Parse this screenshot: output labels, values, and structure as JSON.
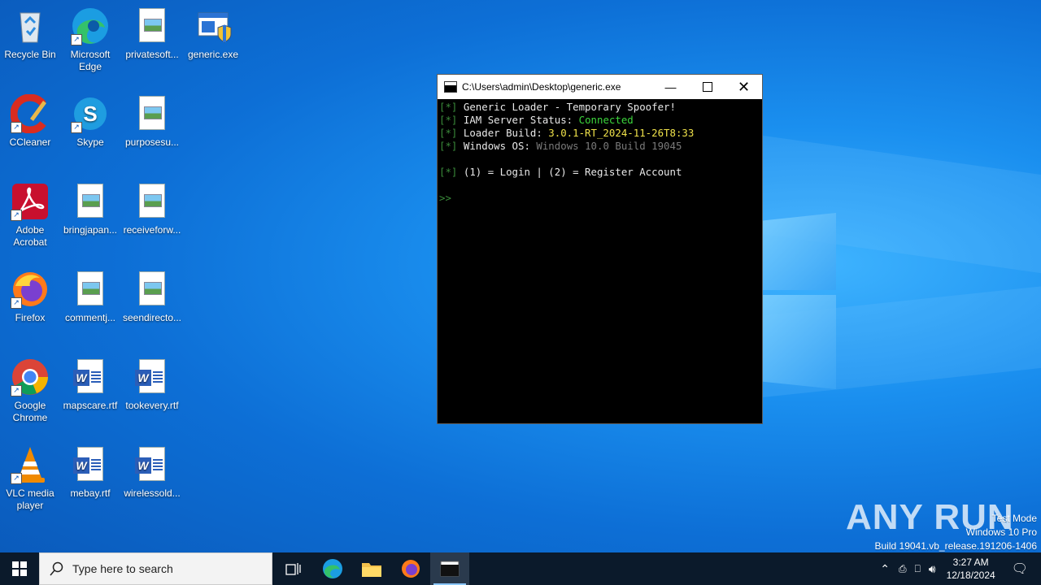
{
  "desktop": {
    "icons": [
      {
        "label": "Recycle Bin",
        "icon": "recycle-bin-icon"
      },
      {
        "label": "Microsoft Edge",
        "icon": "edge-icon"
      },
      {
        "label": "privatesoft...",
        "icon": "image-file-icon"
      },
      {
        "label": "generic.exe",
        "icon": "exe-file-icon"
      },
      {
        "label": "CCleaner",
        "icon": "ccleaner-icon"
      },
      {
        "label": "Skype",
        "icon": "skype-icon"
      },
      {
        "label": "purposesu...",
        "icon": "image-file-icon"
      },
      {
        "label": "Adobe Acrobat",
        "icon": "acrobat-icon"
      },
      {
        "label": "bringjapan...",
        "icon": "image-file-icon"
      },
      {
        "label": "receiveforw...",
        "icon": "image-file-icon"
      },
      {
        "label": "Firefox",
        "icon": "firefox-icon"
      },
      {
        "label": "commentj...",
        "icon": "image-file-icon"
      },
      {
        "label": "seendirecto...",
        "icon": "image-file-icon"
      },
      {
        "label": "Google Chrome",
        "icon": "chrome-icon"
      },
      {
        "label": "mapscare.rtf",
        "icon": "word-file-icon"
      },
      {
        "label": "tookevery.rtf",
        "icon": "word-file-icon"
      },
      {
        "label": "VLC media player",
        "icon": "vlc-icon"
      },
      {
        "label": "mebay.rtf",
        "icon": "word-file-icon"
      },
      {
        "label": "wirelessold...",
        "icon": "word-file-icon"
      }
    ]
  },
  "console": {
    "title": "C:\\Users\\admin\\Desktop\\generic.exe",
    "prefix": "[*]",
    "line1": "Generic Loader - Temporary Spoofer!",
    "line2_label": "IAM Server Status: ",
    "line2_value": "Connected",
    "line3_label": "Loader Build: ",
    "line3_value": "3.0.1-RT_2024-11-26T8:33",
    "line4_label": "Windows OS: ",
    "line4_value": "Windows 10.0 Build 19045",
    "line5": "(1) = Login | (2) = Register Account",
    "prompt": ">>"
  },
  "taskbar": {
    "search_placeholder": "Type here to search",
    "time": "3:27 AM",
    "date": "12/18/2024"
  },
  "watermark": {
    "brand": "ANY RUN",
    "mode": "Test Mode",
    "edition": "Windows 10 Pro",
    "build": "Build 19041.vb_release.191206-1406"
  },
  "colors": {
    "connected": "#3cd63c",
    "build": "#f0e24a",
    "taskbar": "#0b1a2b"
  }
}
